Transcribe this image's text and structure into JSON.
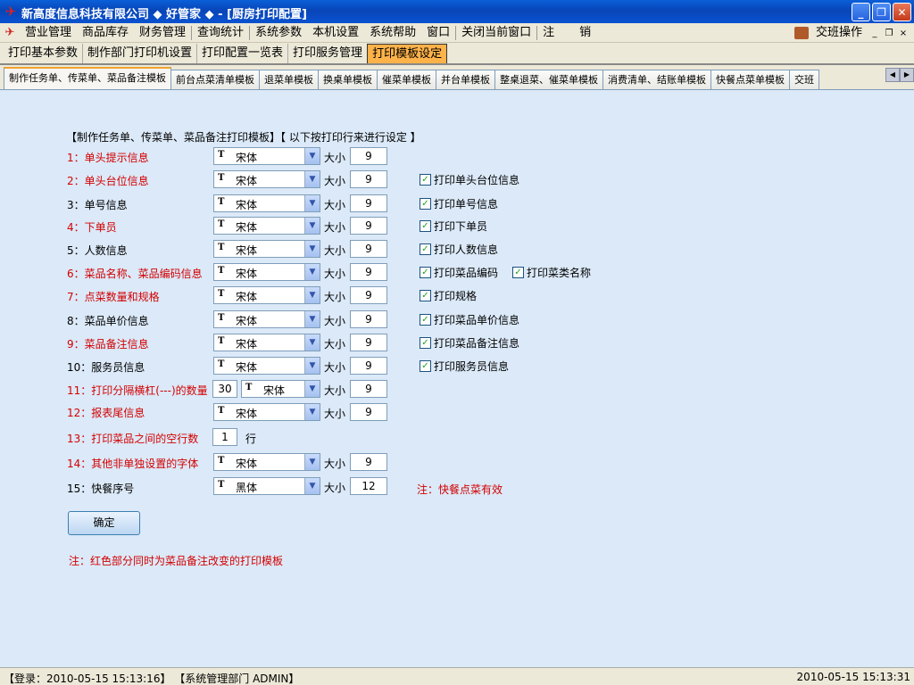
{
  "window": {
    "title": "新高度信息科技有限公司 ◆ 好管家 ◆ - [厨房打印配置]",
    "min": "_",
    "restore": "❐",
    "close": "✕"
  },
  "menu": {
    "items": [
      "营业管理",
      "商品库存",
      "财务管理",
      "查询统计",
      "系统参数",
      "本机设置",
      "系统帮助",
      "窗口",
      "关闭当前窗口",
      "注",
      "销"
    ],
    "shift_label": "交班操作",
    "ctl_min": "_",
    "ctl_restore": "❐",
    "ctl_close": "×"
  },
  "top_tabs": [
    "打印基本参数",
    "制作部门打印机设置",
    "打印配置一览表",
    "打印服务管理",
    "打印模板设定"
  ],
  "sub_tabs": [
    "制作任务单、传菜单、菜品备注模板",
    "前台点菜清单模板",
    "退菜单模板",
    "换桌单模板",
    "催菜单模板",
    "并台单模板",
    "整桌退菜、催菜单模板",
    "消费清单、结账单模板",
    "快餐点菜单模板",
    "交班"
  ],
  "form": {
    "heading": "【制作任务单、传菜单、菜品备注打印模板】【 以下按打印行来进行设定 】",
    "size_label": "大小",
    "rows_unit": "行",
    "rows": [
      {
        "label": "1：单头提示信息",
        "font": "宋体",
        "size": "9"
      },
      {
        "label": "2：单头台位信息",
        "font": "宋体",
        "size": "9",
        "checks": [
          "打印单头台位信息"
        ]
      },
      {
        "label": "3：单号信息",
        "font": "宋体",
        "size": "9",
        "checks": [
          "打印单号信息"
        ]
      },
      {
        "label": "4：下单员",
        "font": "宋体",
        "size": "9",
        "checks": [
          "打印下单员"
        ]
      },
      {
        "label": "5：人数信息",
        "font": "宋体",
        "size": "9",
        "checks": [
          "打印人数信息"
        ]
      },
      {
        "label": "6：菜品名称、菜品编码信息",
        "font": "宋体",
        "size": "9",
        "checks": [
          "打印菜品编码",
          "打印菜类名称"
        ]
      },
      {
        "label": "7：点菜数量和规格",
        "font": "宋体",
        "size": "9",
        "checks": [
          "打印规格"
        ]
      },
      {
        "label": "8：菜品单价信息",
        "font": "宋体",
        "size": "9",
        "checks": [
          "打印菜品单价信息"
        ]
      },
      {
        "label": "9：菜品备注信息",
        "font": "宋体",
        "size": "9",
        "checks": [
          "打印菜品备注信息"
        ]
      },
      {
        "label": "10：服务员信息",
        "font": "宋体",
        "size": "9",
        "checks": [
          "打印服务员信息"
        ]
      },
      {
        "label": "11：打印分隔横杠(---)的数量",
        "count": "30",
        "font": "宋体",
        "size": "9"
      },
      {
        "label": "12：报表尾信息",
        "font": "宋体",
        "size": "9"
      },
      {
        "label": "13：打印菜品之间的空行数",
        "count": "1"
      },
      {
        "label": "14：其他非单独设置的字体",
        "font": "宋体",
        "size": "9"
      },
      {
        "label": "15：快餐序号",
        "font": "黑体",
        "size": "12"
      }
    ],
    "fastfood_note": "注：快餐点菜有效",
    "ok_button": "确定",
    "footer_note": "注：红色部分同时为菜品备注改变的打印模板"
  },
  "status": {
    "left": "【登录：2010-05-15 15:13:16】 【系统管理部门  ADMIN】",
    "right": "2010-05-15 15:13:31"
  },
  "colors": {
    "accent_red": "#d40000",
    "panel_bg": "#dbe9f8",
    "active_tab": "#fdb24a"
  }
}
